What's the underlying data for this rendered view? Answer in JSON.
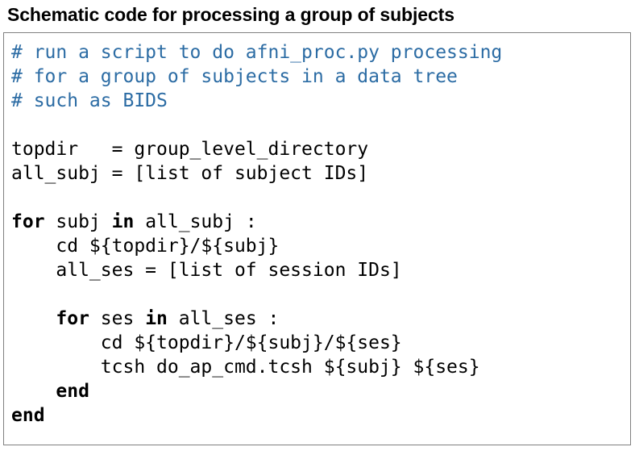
{
  "title": "Schematic code for processing a group of subjects",
  "colors": {
    "comment": "#2c6ca4",
    "code": "#000000",
    "box_border": "#808080",
    "background": "#ffffff"
  },
  "code_block": {
    "language": "tcsh",
    "lines": [
      {
        "id": "l1",
        "indent": "",
        "type": "comment",
        "text": "# run a script to do afni_proc.py processing"
      },
      {
        "id": "l2",
        "indent": "",
        "type": "comment",
        "text": "# for a group of subjects in a data tree"
      },
      {
        "id": "l3",
        "indent": "",
        "type": "comment",
        "text": "# such as BIDS"
      },
      {
        "id": "l4",
        "indent": "",
        "type": "blank",
        "text": ""
      },
      {
        "id": "l5",
        "indent": "",
        "type": "code",
        "text": "topdir   = group_level_directory"
      },
      {
        "id": "l6",
        "indent": "",
        "type": "code",
        "text": "all_subj = [list of subject IDs]"
      },
      {
        "id": "l7",
        "indent": "",
        "type": "blank",
        "text": ""
      },
      {
        "id": "l8",
        "indent": "",
        "type": "code",
        "keyword_head": "for",
        "mid_plain": " subj ",
        "keyword_mid": "in",
        "tail": " all_subj :",
        "text": "for subj in all_subj :"
      },
      {
        "id": "l9",
        "indent": "    ",
        "type": "code",
        "text": "    cd ${topdir}/${subj}"
      },
      {
        "id": "l10",
        "indent": "    ",
        "type": "code",
        "text": "    all_ses = [list of session IDs]"
      },
      {
        "id": "l11",
        "indent": "",
        "type": "blank",
        "text": ""
      },
      {
        "id": "l12",
        "indent": "    ",
        "type": "code",
        "keyword_head": "for",
        "mid_plain": " ses ",
        "keyword_mid": "in",
        "tail": " all_ses :",
        "text": "    for ses in all_ses :"
      },
      {
        "id": "l13",
        "indent": "        ",
        "type": "code",
        "text": "        cd ${topdir}/${subj}/${ses}"
      },
      {
        "id": "l14",
        "indent": "        ",
        "type": "code",
        "text": "        tcsh do_ap_cmd.tcsh ${subj} ${ses}"
      },
      {
        "id": "l15",
        "indent": "    ",
        "type": "code",
        "keyword_head": "end",
        "text": "    end"
      },
      {
        "id": "l16",
        "indent": "",
        "type": "code",
        "keyword_head": "end",
        "text": "end"
      }
    ]
  }
}
